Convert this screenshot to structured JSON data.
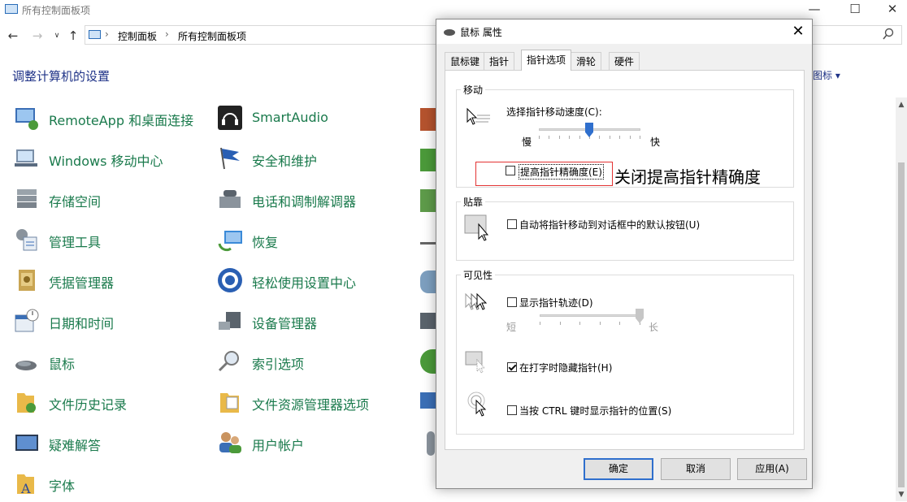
{
  "window": {
    "title": "所有控制面板项",
    "controls": {
      "minimize": "—",
      "maximize": "☐",
      "close": "✕"
    }
  },
  "address_bar": {
    "breadcrumbs": [
      "控制面板",
      "所有控制面板项"
    ],
    "separator": "›"
  },
  "heading": "调整计算机的设置",
  "view_by": {
    "label": "图标",
    "arrow": "▾"
  },
  "items_col1": [
    {
      "label": "RemoteApp 和桌面连接",
      "icon": "remoteapp-icon"
    },
    {
      "label": "Windows 移动中心",
      "icon": "mobility-center-icon"
    },
    {
      "label": "存储空间",
      "icon": "storage-spaces-icon"
    },
    {
      "label": "管理工具",
      "icon": "admin-tools-icon"
    },
    {
      "label": "凭据管理器",
      "icon": "credential-manager-icon"
    },
    {
      "label": "日期和时间",
      "icon": "date-time-icon"
    },
    {
      "label": "鼠标",
      "icon": "mouse-icon"
    },
    {
      "label": "文件历史记录",
      "icon": "file-history-icon"
    },
    {
      "label": "疑难解答",
      "icon": "troubleshooting-icon"
    },
    {
      "label": "字体",
      "icon": "fonts-icon"
    }
  ],
  "items_col2": [
    {
      "label": "SmartAudio",
      "icon": "smartaudio-icon"
    },
    {
      "label": "安全和维护",
      "icon": "security-maintenance-icon"
    },
    {
      "label": "电话和调制解调器",
      "icon": "phone-modem-icon"
    },
    {
      "label": "恢复",
      "icon": "recovery-icon"
    },
    {
      "label": "轻松使用设置中心",
      "icon": "ease-of-access-icon"
    },
    {
      "label": "设备管理器",
      "icon": "device-manager-icon"
    },
    {
      "label": "索引选项",
      "icon": "indexing-options-icon"
    },
    {
      "label": "文件资源管理器选项",
      "icon": "explorer-options-icon"
    },
    {
      "label": "用户帐户",
      "icon": "user-accounts-icon"
    }
  ],
  "dialog": {
    "title": "鼠标 属性",
    "close": "✕",
    "tabs": [
      "鼠标键",
      "指针",
      "指针选项",
      "滑轮",
      "硬件"
    ],
    "active_tab": 2,
    "motion": {
      "title": "移动",
      "speed_label": "选择指针移动速度(C):",
      "slow": "慢",
      "fast": "快",
      "speed_value": 6,
      "speed_max": 11,
      "enhance_precision": {
        "label": "提高指针精确度(E)",
        "checked": false
      }
    },
    "snap_to": {
      "title": "贴靠",
      "label": "自动将指针移动到对话框中的默认按钮(U)",
      "checked": false
    },
    "visibility": {
      "title": "可见性",
      "trails": {
        "label": "显示指针轨迹(D)",
        "checked": false,
        "short": "短",
        "long": "长",
        "value": 1.0
      },
      "hide_typing": {
        "label": "在打字时隐藏指针(H)",
        "checked": true
      },
      "show_location": {
        "label": "当按 CTRL 键时显示指针的位置(S)",
        "checked": false
      }
    },
    "buttons": {
      "ok": "确定",
      "cancel": "取消",
      "apply": "应用(A)"
    }
  },
  "annotation": {
    "text": "关闭提高指针精确度",
    "color": "#e33333"
  }
}
